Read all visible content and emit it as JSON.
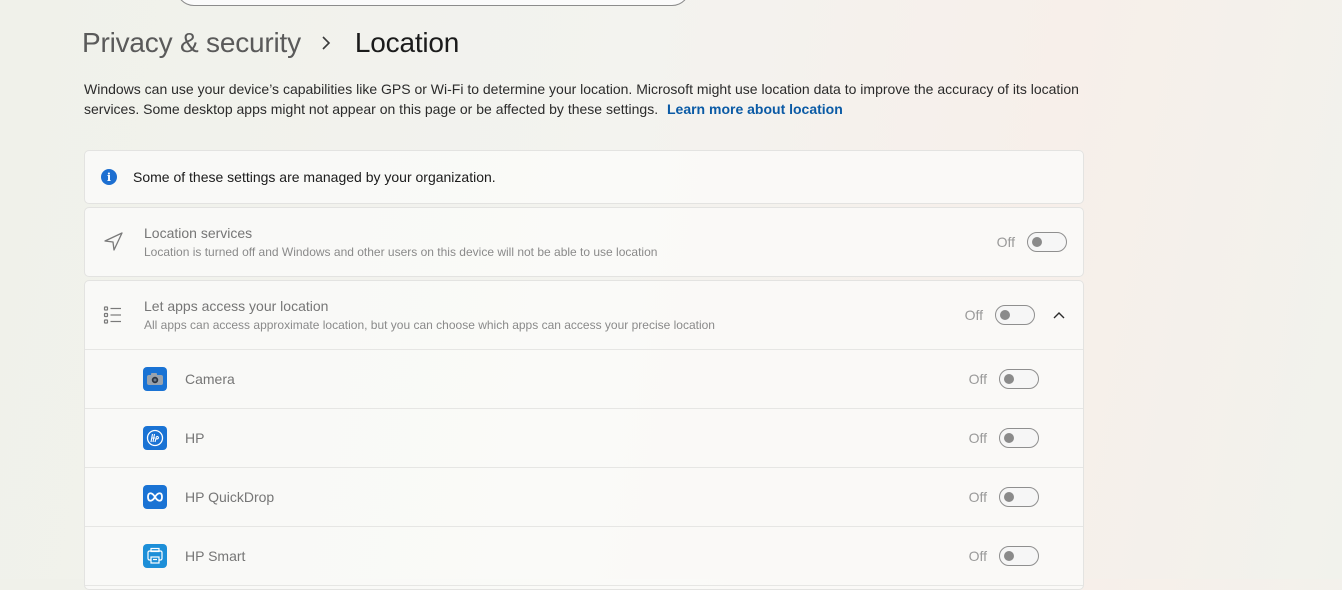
{
  "breadcrumb": {
    "parent": "Privacy & security",
    "current": "Location"
  },
  "description": {
    "text": "Windows can use your device’s capabilities like GPS or Wi-Fi to determine your location. Microsoft might use location data to improve the accuracy of its location services. Some desktop apps might not appear on this page or be affected by these settings.",
    "link": "Learn more about location"
  },
  "info_banner": {
    "icon": "info-icon",
    "text": "Some of these settings are managed by your organization."
  },
  "location_services": {
    "icon": "navigation-arrow-icon",
    "title": "Location services",
    "subtitle": "Location is turned off and Windows and other users on this device will not be able to use location",
    "state_label": "Off",
    "enabled": false
  },
  "apps_access": {
    "icon": "list-icon",
    "title": "Let apps access your location",
    "subtitle": "All apps can access approximate location, but you can choose which apps can access your precise location",
    "state_label": "Off",
    "enabled": false,
    "expanded": true,
    "apps": [
      {
        "name": "Camera",
        "icon": "camera-app-icon",
        "state_label": "Off",
        "enabled": false
      },
      {
        "name": "HP",
        "icon": "hp-app-icon",
        "state_label": "Off",
        "enabled": false
      },
      {
        "name": "HP QuickDrop",
        "icon": "hp-quickdrop-app-icon",
        "state_label": "Off",
        "enabled": false
      },
      {
        "name": "HP Smart",
        "icon": "hp-smart-app-icon",
        "state_label": "Off",
        "enabled": false
      }
    ]
  },
  "colors": {
    "accent": "#1d6fd1",
    "link": "#0a5aa5",
    "app_tile": "#1a73d4"
  }
}
